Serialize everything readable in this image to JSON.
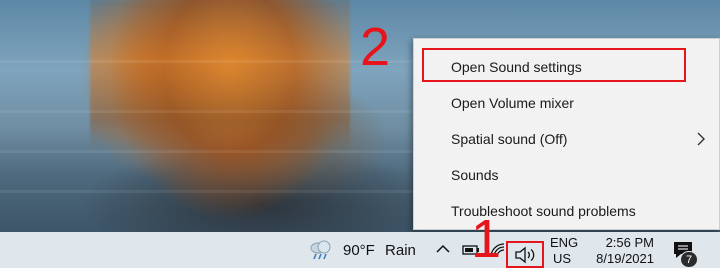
{
  "context_menu": {
    "items": [
      {
        "label": "Open Sound settings"
      },
      {
        "label": "Open Volume mixer"
      },
      {
        "label": "Spatial sound (Off)",
        "has_submenu": true
      },
      {
        "label": "Sounds"
      },
      {
        "label": "Troubleshoot sound problems"
      }
    ]
  },
  "annotations": {
    "step_1": "1",
    "step_2": "2",
    "color": "#e8141b"
  },
  "taskbar": {
    "weather": {
      "temperature": "90°F",
      "condition": "Rain",
      "icon": "rain-cloud-icon"
    },
    "tray_icons": [
      "chevron-up-icon",
      "battery-icon",
      "wifi-icon",
      "volume-icon"
    ],
    "language": {
      "line1": "ENG",
      "line2": "US"
    },
    "clock": {
      "time": "2:56 PM",
      "date": "8/19/2021"
    },
    "notifications": {
      "count": "7",
      "icon": "notification-icon"
    }
  }
}
